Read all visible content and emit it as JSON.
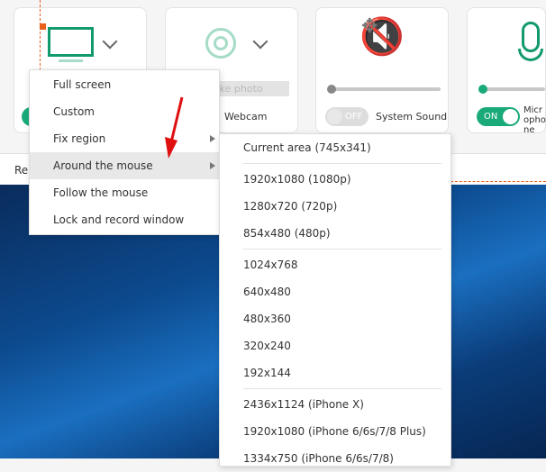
{
  "cards": {
    "screen": {
      "toggle": "ON"
    },
    "webcam": {
      "button": "Take photo",
      "label": "Webcam"
    },
    "system_sound": {
      "toggle": "OFF",
      "label": "System Sound",
      "volume": 0
    },
    "microphone": {
      "toggle": "ON",
      "label": "Microphone",
      "volume": 0
    }
  },
  "strip_text": "Re",
  "menu": {
    "items": [
      {
        "label": "Full screen"
      },
      {
        "label": "Custom"
      },
      {
        "label": "Fix region",
        "submenu": true
      },
      {
        "label": "Around the mouse",
        "submenu": true,
        "selected": true
      },
      {
        "label": "Follow the mouse"
      },
      {
        "label": "Lock and record window"
      }
    ]
  },
  "submenu": {
    "groups": [
      [
        "Current area (745x341)"
      ],
      [
        "1920x1080 (1080p)",
        "1280x720 (720p)",
        "854x480 (480p)"
      ],
      [
        "1024x768",
        "640x480",
        "480x360",
        "320x240",
        "192x144"
      ],
      [
        "2436x1124 (iPhone X)",
        "1920x1080 (iPhone 6/6s/7/8 Plus)",
        "1334x750 (iPhone 6/6s/7/8)"
      ]
    ]
  },
  "colors": {
    "accent": "#1aaa7a",
    "annotation": "#e8601c"
  }
}
